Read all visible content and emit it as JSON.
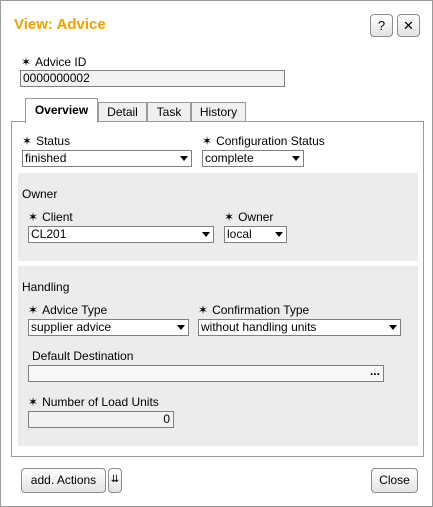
{
  "dialog": {
    "title": "View: Advice",
    "help_label": "?",
    "close_icon_glyph": "✕"
  },
  "advice_id": {
    "label": "Advice ID",
    "value": "0000000002"
  },
  "tabs": [
    {
      "label": "Overview",
      "active": true
    },
    {
      "label": "Detail",
      "active": false
    },
    {
      "label": "Task",
      "active": false
    },
    {
      "label": "History",
      "active": false
    }
  ],
  "overview": {
    "status": {
      "label": "Status",
      "value": "finished"
    },
    "configuration_status": {
      "label": "Configuration Status",
      "value": "complete"
    },
    "owner_group": {
      "title": "Owner",
      "client": {
        "label": "Client",
        "value": "CL201"
      },
      "owner": {
        "label": "Owner",
        "value": "local"
      }
    },
    "handling_group": {
      "title": "Handling",
      "advice_type": {
        "label": "Advice Type",
        "value": "supplier advice"
      },
      "confirmation_type": {
        "label": "Confirmation Type",
        "value": "without handling units"
      },
      "default_destination": {
        "label": "Default Destination",
        "value": "",
        "browse_label": "..."
      },
      "load_units": {
        "label": "Number of Load Units",
        "value": "0"
      }
    }
  },
  "footer": {
    "add_actions_label": "add. Actions",
    "close_label": "Close"
  },
  "required_marker": "✶",
  "colors": {
    "title": "#f0a000",
    "group_bg": "#ececec",
    "field_bg": "#f2f2f2"
  }
}
